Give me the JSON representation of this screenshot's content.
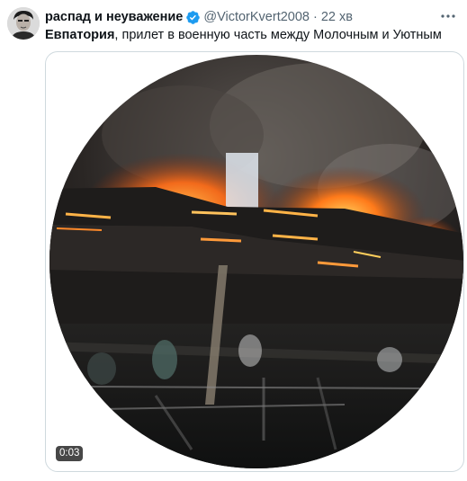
{
  "tweet": {
    "display_name": "распад и неуважение",
    "handle": "@VictorKvert2008",
    "separator": "·",
    "timestamp": "22 хв",
    "text_bold": "Евпатория",
    "text_rest": ", прилет в военную часть между Молочным и Уютным",
    "avatar_icon": "avatar-portrait",
    "verified_icon": "verified-badge-icon",
    "more_icon": "more-options-icon"
  },
  "media": {
    "type": "video",
    "duration": "0:03",
    "description_icon": "video-thumbnail"
  },
  "colors": {
    "verified": "#1d9bf0",
    "secondary_text": "#536471",
    "border": "#cfd9de",
    "fire": "#ff7a1a"
  }
}
